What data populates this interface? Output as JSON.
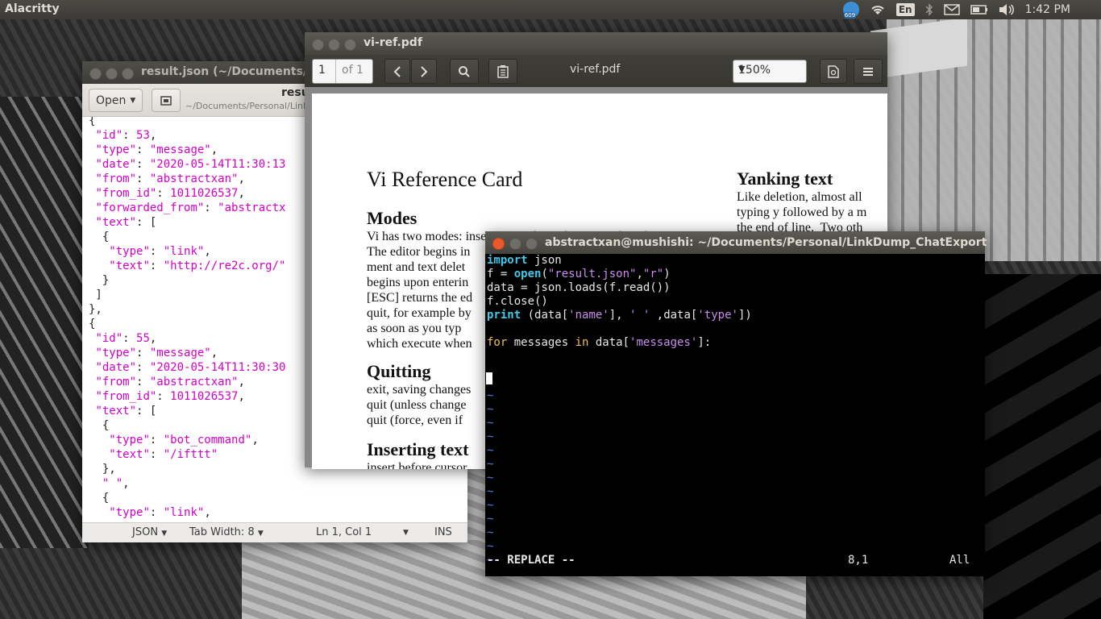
{
  "topbar": {
    "app_title": "Alacritty",
    "notification_count": "609",
    "keyboard_layout": "En",
    "clock": "1:42 PM",
    "icons": [
      "update-badge-icon",
      "wifi-icon",
      "keyboard-layout-indicator",
      "bluetooth-icon",
      "mail-icon",
      "battery-icon",
      "volume-icon"
    ]
  },
  "gedit": {
    "window_title": "result.json (~/Documents/Pe",
    "open_label": "Open",
    "tab_title": "result.js",
    "tab_path": "~/Documents/Personal/Link",
    "lines": [
      "{",
      " \"id\": 53,",
      " \"type\": \"message\",",
      " \"date\": \"2020-05-14T11:30:13",
      " \"from\": \"abstractxan\",",
      " \"from_id\": 1011026537,",
      " \"forwarded_from\": \"abstractx",
      " \"text\": [",
      "  {",
      "   \"type\": \"link\",",
      "   \"text\": \"http://re2c.org/\"",
      "  }",
      " ]",
      "},",
      "{",
      " \"id\": 55,",
      " \"type\": \"message\",",
      " \"date\": \"2020-05-14T11:30:30",
      " \"from\": \"abstractxan\",",
      " \"from_id\": 1011026537,",
      " \"text\": [",
      "  {",
      "   \"type\": \"bot_command\",",
      "   \"text\": \"/ifttt\"",
      "  },",
      "  \" \",",
      "  {",
      "   \"type\": \"link\","
    ],
    "status": {
      "language": "JSON",
      "tab_width": "Tab Width: 8",
      "position": "Ln 1, Col 1",
      "mode": "INS"
    }
  },
  "evince": {
    "window_title": "vi-ref.pdf",
    "page_current": "1",
    "page_total": "of 1",
    "doc_title": "vi-ref.pdf",
    "zoom": "150%",
    "pdf": {
      "title": "Vi Reference Card",
      "modes_heading": "Modes",
      "modes_text": "Vi has two modes: insertion mode, and command mode.\nThe editor begins in\nment and text delet\nbegins upon enterin\n[ESC] returns the ed\nquit, for example by\nas soon as you typ\nwhich execute when",
      "quitting_heading": "Quitting",
      "quitting_text": "exit, saving changes\nquit (unless change\nquit (force, even if",
      "inserting_heading": "Inserting text",
      "inserting_text": "insert before cursor",
      "yanking_heading": "Yanking text",
      "yanking_text": "Like deletion, almost all\ntyping y followed by a m\nthe end of line.  Two oth"
    }
  },
  "terminal": {
    "window_title": "abstractxan@mushishi: ~/Documents/Personal/LinkDump_ChatExport",
    "code": {
      "l1_kw": "import",
      "l1_rest": " json",
      "l2_a": "f = ",
      "l2_fn": "open",
      "l2_b": "(",
      "l2_s1": "\"result.json\"",
      "l2_c": ",",
      "l2_s2": "\"r\"",
      "l2_d": ")",
      "l3": "data = json.loads(f.read())",
      "l4": "f.close()",
      "l5_fn": "print",
      "l5_a": " (data[",
      "l5_s1": "'name'",
      "l5_b": "], ",
      "l5_s2": "' '",
      "l5_c": " ,data[",
      "l5_s3": "'type'",
      "l5_d": "])",
      "l7_kw1": "for",
      "l7_a": " messages ",
      "l7_kw2": "in",
      "l7_b": " data[",
      "l7_s1": "'messages'",
      "l7_c": "]:"
    },
    "tilde": "~",
    "mode": "-- REPLACE --",
    "cursor_pos": "8,1",
    "scroll_pos": "All"
  }
}
